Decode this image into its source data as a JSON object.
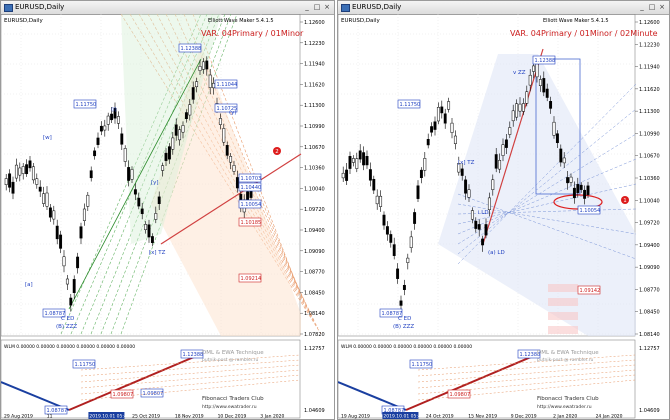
{
  "windows": [
    {
      "title": "EURUSD,Daily",
      "symbol": "EURUSD,Daily",
      "indicator": "Elliott Wave Maker 5.4.1.5",
      "wave_title": "VAR. 04Primary / 01Minor",
      "price_scale": [
        "1.12600",
        "1.12230",
        "1.11940",
        "1.11620",
        "1.11300",
        "1.10990",
        "1.10670",
        "1.10360",
        "1.10040",
        "1.09720",
        "1.09400",
        "1.09090",
        "1.08770",
        "1.08450",
        "1.08140",
        "1.07820"
      ],
      "price_boxes": [
        "1.12388",
        "1.11750",
        "1.11044",
        "1.10725",
        "1.10703",
        "1.10440",
        "1.10054",
        "1.10185",
        "1.09214",
        "1.08787",
        "1.09807"
      ],
      "wave_labels": [
        "C ED",
        "(B) ZZZ",
        "[x] TZ",
        "[a]",
        "(i)",
        "[w]",
        "(y)",
        "[y]"
      ],
      "marker": "2",
      "date_labels": [
        "29 Aug 2019",
        "11",
        "2019.10.01 05:48",
        "25 Oct 2019",
        "18 Nov 2019",
        "10 Dec 2019",
        "3 Jan 2020"
      ],
      "sub_indicator": "WLM 0.00000 0.00000 0.00000 0.00000 0.00000 0.00000",
      "sub_scale": [
        "1.12757",
        "1.04609"
      ],
      "sub_boxes": [
        "1.12388",
        "1.11750",
        "1.09807",
        "1.08787"
      ],
      "watermark1": "DML & EWA Technique",
      "watermark2": "putnik-post @ rambler.ru",
      "watermark3": "Fibonacci Traders Club",
      "watermark4": "http://www.ewatrader.ru"
    },
    {
      "title": "EURUSD,Daily",
      "symbol": "EURUSD,Daily",
      "indicator": "Elliott Wave Maker 5.4.1.5",
      "wave_title": "VAR. 04Primary / 01Minor / 02Minute",
      "price_scale": [
        "1.12600",
        "1.12230",
        "1.11940",
        "1.11620",
        "1.11300",
        "1.10990",
        "1.10670",
        "1.10360",
        "1.10040",
        "1.09720",
        "1.09400",
        "1.09090",
        "1.08770",
        "1.08450",
        "1.08140"
      ],
      "price_boxes": [
        "1.12388",
        "1.11750",
        "1.10054",
        "1.09142",
        "1.08787"
      ],
      "wave_labels": [
        "C ED",
        "(B) ZZZ",
        "(a) LD",
        "i LD",
        "v ZZ",
        "[x] TZ"
      ],
      "marker": "1",
      "date_labels": [
        "19 Aug 2019",
        "2019.10.01 05:48",
        "24 Oct 2019",
        "15 Nov 2019",
        "9 Dec 2019",
        "2 Jan 2020",
        "24 Jan 2020"
      ],
      "sub_indicator": "WLM 0.00000 0.00000 0.00000 0.00000 0.00000 0.00000",
      "sub_scale": [
        "1.12757",
        "1.04609"
      ],
      "sub_boxes": [
        "1.12388",
        "1.11750",
        "1.09807",
        "1.08787"
      ],
      "watermark1": "DML & EWA Technique",
      "watermark2": "putnik-post @ rambler.ru",
      "watermark3": "Fibonacci Traders Club",
      "watermark4": "http://www.ewatrader.ru"
    }
  ],
  "colors": {
    "accent_red": "#cc2020",
    "box_blue": "#2040c0",
    "bull": "#ffffff",
    "bear": "#000000",
    "fib_orange": "#f0a070",
    "fib_green": "#60b060"
  }
}
